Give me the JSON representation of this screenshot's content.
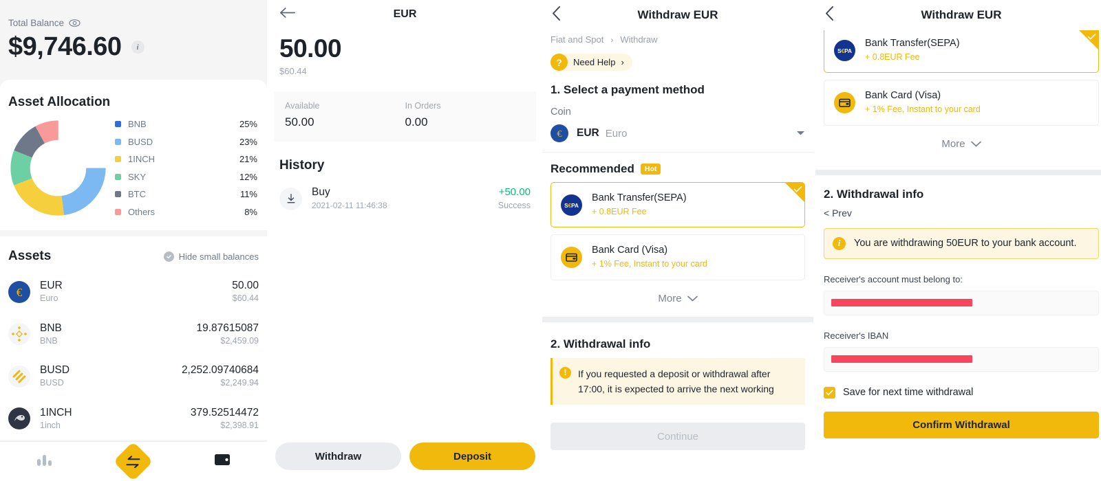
{
  "panel1": {
    "balance": {
      "label": "Total Balance",
      "eye_icon": "eye-icon",
      "amount": "$9,746.60",
      "info_icon": "info-icon",
      "info_char": "i"
    },
    "allocation": {
      "title": "Asset Allocation"
    },
    "assets": {
      "title": "Assets",
      "hide_small_label": "Hide small balances",
      "check_icon": "check-icon",
      "rows": [
        {
          "symbol": "EUR",
          "name": "Euro",
          "amount": "50.00",
          "usd": "$60.44",
          "icon": "eur-coin-icon"
        },
        {
          "symbol": "BNB",
          "name": "BNB",
          "amount": "19.87615087",
          "usd": "$2,459.09",
          "icon": "bnb-coin-icon"
        },
        {
          "symbol": "BUSD",
          "name": "BUSD",
          "amount": "2,252.09740684",
          "usd": "$2,249.94",
          "icon": "busd-coin-icon"
        },
        {
          "symbol": "1INCH",
          "name": "1inch",
          "amount": "379.52514472",
          "usd": "$2,398.91",
          "icon": "1inch-coin-icon"
        }
      ]
    },
    "nav": [
      {
        "name": "markets-tab",
        "icon": "bar-chart-icon"
      },
      {
        "name": "trade-tab",
        "icon": "swap-arrows-icon"
      },
      {
        "name": "wallet-tab",
        "icon": "wallet-icon"
      }
    ]
  },
  "panel2": {
    "title": "EUR",
    "back_icon": "arrow-left-icon",
    "amount": "50.00",
    "usd": "$60.44",
    "stats": [
      {
        "label": "Available",
        "value": "50.00"
      },
      {
        "label": "In Orders",
        "value": "0.00"
      }
    ],
    "history_title": "History",
    "history": [
      {
        "type": "Buy",
        "date": "2021-02-11 11:46:38",
        "amount": "+50.00",
        "status": "Success",
        "icon": "download-icon"
      }
    ],
    "withdraw_label": "Withdraw",
    "deposit_label": "Deposit"
  },
  "panel3": {
    "title": "Withdraw EUR",
    "back_icon": "chevron-left-icon",
    "breadcrumb": {
      "root": "Fiat and Spot",
      "sep": "›",
      "current": "Withdraw"
    },
    "help": {
      "q": "?",
      "label": "Need Help",
      "chevron": "›"
    },
    "step1_title": "1. Select a payment method",
    "coin_label": "Coin",
    "coin": {
      "symbol": "EUR",
      "name": "Euro",
      "icon": "eur-coin-icon",
      "caret": "chevron-down-icon"
    },
    "recommended_label": "Recommended",
    "hot_badge": "Hot",
    "methods": [
      {
        "name": "Bank Transfer(SEPA)",
        "fee": "+ 0.8EUR Fee",
        "icon": "sepa-icon",
        "selected": true
      },
      {
        "name": "Bank Card (Visa)",
        "fee": "+ 1% Fee, Instant to your card",
        "icon": "credit-card-icon",
        "selected": false
      }
    ],
    "more_label": "More",
    "step2_title": "2. Withdrawal info",
    "warning": "If you requested a deposit or withdrawal after 17:00, it is expected to arrive the next working",
    "continue_label": "Continue"
  },
  "panel4": {
    "title": "Withdraw EUR",
    "back_icon": "chevron-left-icon",
    "methods": [
      {
        "name": "Bank Transfer(SEPA)",
        "fee": "+ 0.8EUR Fee",
        "icon": "sepa-icon",
        "selected": true
      },
      {
        "name": "Bank Card (Visa)",
        "fee": "+ 1% Fee, Instant to your card",
        "icon": "credit-card-icon",
        "selected": false
      }
    ],
    "more_label": "More",
    "step2_title": "2. Withdrawal info",
    "prev_label": "< Prev",
    "info": "You are withdrawing 50EUR to your bank account.",
    "field1_label": "Receiver's account must belong to:",
    "field1_value": "",
    "field2_label": "Receiver's IBAN",
    "field2_value": "",
    "save_label": "Save for next time withdrawal",
    "confirm_label": "Confirm Withdrawal"
  },
  "chart_data": {
    "type": "pie",
    "title": "Asset Allocation",
    "legend_position": "right",
    "categories": [
      "BNB",
      "BUSD",
      "1INCH",
      "SKY",
      "BTC",
      "Others"
    ],
    "values": [
      25,
      23,
      21,
      12,
      11,
      8
    ],
    "labels": [
      "25%",
      "23%",
      "21%",
      "12%",
      "11%",
      "8%"
    ],
    "colors": [
      "#2d6fd6",
      "#7cb9f0",
      "#f5cf3e",
      "#6dcfa4",
      "#6f7889",
      "#f89a9a"
    ],
    "unit": "%"
  },
  "colors": {
    "brand_yellow": "#f0b90b",
    "success_green": "#02c076",
    "redact_red": "#f6465d",
    "text_primary": "#1e2329",
    "text_secondary": "#707a8a"
  }
}
